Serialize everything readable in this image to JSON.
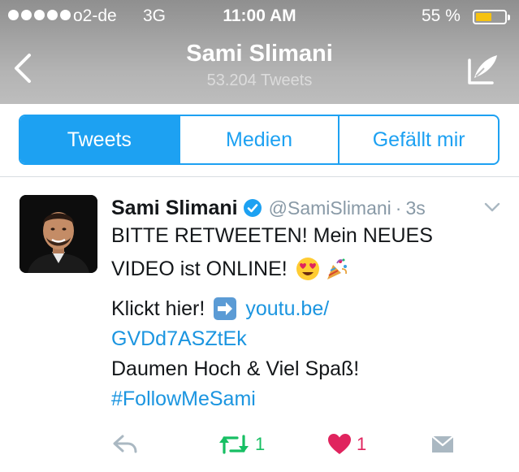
{
  "status_bar": {
    "carrier": "o2-de",
    "network": "3G",
    "time": "11:00 AM",
    "battery_percent": "55 %",
    "battery_level": 0.55,
    "battery_color": "#f5c211"
  },
  "header": {
    "name": "Sami Slimani",
    "tweet_count": "53.204 Tweets",
    "back_icon": "chevron-left-icon",
    "compose_icon": "compose-tweet-icon"
  },
  "tabs": [
    {
      "label": "Tweets",
      "active": true
    },
    {
      "label": "Medien",
      "active": false
    },
    {
      "label": "Gefällt mir",
      "active": false
    }
  ],
  "tweet": {
    "author_name": "Sami Slimani",
    "verified": true,
    "handle": "@SamiSlimani",
    "separator": "·",
    "time": "3s",
    "line1": "BITTE RETWEETEN! Mein NEUES",
    "line2": "VIDEO ist ONLINE!",
    "line3_text": "Klickt hier!",
    "link_part1": "youtu.be/",
    "link_part2": "GVDd7ASZtEk",
    "line5": "Daumen Hoch & Viel Spaß!",
    "hashtag": "#FollowMeSami",
    "actions": {
      "retweet_count": "1",
      "like_count": "1"
    }
  },
  "colors": {
    "accent": "#1da1f2",
    "link": "#1b95e0",
    "retweet": "#17bf63",
    "like": "#e0245e",
    "muted": "#8899a6"
  }
}
